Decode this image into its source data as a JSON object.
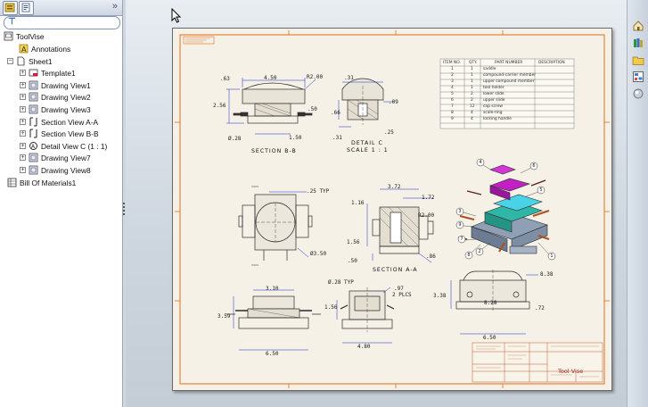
{
  "feature_tree": {
    "tabs": [
      "feature-manager-tab",
      "property-manager-tab"
    ],
    "filter_icon": "filter-icon",
    "nodes": [
      {
        "label": "ToolVise",
        "icon": "drawing-document-icon",
        "level": 0,
        "expander": ""
      },
      {
        "label": "Annotations",
        "icon": "annotations-icon",
        "level": 1,
        "expander": ""
      },
      {
        "label": "Sheet1",
        "icon": "sheet-icon",
        "level": 1,
        "expander": "−"
      },
      {
        "label": "Template1",
        "icon": "sheet-format-icon",
        "level": 2,
        "expander": "+"
      },
      {
        "label": "Drawing View1",
        "icon": "drawing-view-icon",
        "level": 2,
        "expander": "+"
      },
      {
        "label": "Drawing View2",
        "icon": "drawing-view-icon",
        "level": 2,
        "expander": "+"
      },
      {
        "label": "Drawing View3",
        "icon": "drawing-view-icon",
        "level": 2,
        "expander": "+"
      },
      {
        "label": "Section View A-A",
        "icon": "section-view-icon",
        "level": 2,
        "expander": "+"
      },
      {
        "label": "Section View B-B",
        "icon": "section-view-icon",
        "level": 2,
        "expander": "+"
      },
      {
        "label": "Detail View C (1 : 1)",
        "icon": "detail-view-icon",
        "level": 2,
        "expander": "+"
      },
      {
        "label": "Drawing View7",
        "icon": "drawing-view-icon",
        "level": 2,
        "expander": "+"
      },
      {
        "label": "Drawing View8",
        "icon": "drawing-view-icon",
        "level": 2,
        "expander": "+"
      },
      {
        "label": "Bill Of Materials1",
        "icon": "bom-table-icon",
        "level": 1,
        "expander": ""
      }
    ]
  },
  "drawing": {
    "title_block_title": "Tool Vise",
    "view_labels": {
      "section_bb": "SECTION B-B",
      "detail_c": "DETAIL C",
      "detail_scale": "SCALE 1 : 1",
      "section_aa": "SECTION A-A"
    },
    "bom": {
      "headers": [
        "ITEM NO.",
        "QTY.",
        "PART NUMBER",
        "DESCRIPTION"
      ],
      "rows": [
        [
          "1",
          "1",
          "saddle",
          ""
        ],
        [
          "2",
          "1",
          "compound-carrier member",
          ""
        ],
        [
          "3",
          "1",
          "upper compound member",
          ""
        ],
        [
          "4",
          "1",
          "tool holder",
          ""
        ],
        [
          "5",
          "2",
          "lower slide",
          ""
        ],
        [
          "6",
          "2",
          "upper slide",
          ""
        ],
        [
          "7",
          "12",
          "cap screw",
          ""
        ],
        [
          "8",
          "4",
          "scale-ring",
          ""
        ],
        [
          "9",
          "4",
          "locking handle",
          ""
        ]
      ]
    },
    "dimensions": {
      "d450": "4.50",
      "d63": ".63",
      "r200": "R2.00",
      "d256": "2.56",
      "d50": ".50",
      "d150": "1.50",
      "dia28": "Ø.28",
      "d31a": ".31",
      "d66": ".66",
      "d09": ".09",
      "d31b": ".31",
      "d25": ".25",
      "d25typ": ".25 TYP",
      "dia350": "Ø3.50",
      "d372": "3.72",
      "d172": "1.72",
      "d116": "1.16",
      "r200b": "R2.00",
      "d156a": "1.56",
      "d50b": ".50",
      "d86": ".86",
      "d838a": "8.38",
      "d338": "3.38",
      "d828": "8.28",
      "d72": ".72",
      "d650a": "6.50",
      "d310": "3.10",
      "d359": "3.59",
      "d650b": "6.50",
      "dia28typ": "Ø.28 TYP",
      "d97": ".97",
      "d2plcs": "2 PLCS",
      "d156b": "1.56",
      "d480": "4.80"
    },
    "balloons": [
      "4",
      "6",
      "5",
      "3",
      "9",
      "7",
      "8",
      "2",
      "1"
    ]
  },
  "colors": {
    "sheet": "#f5f1e6",
    "border_orange": "#e0701c",
    "dimension_blue": "#1b2bd0",
    "geometry": "#2b2b2b",
    "title_red": "#9a1d1d",
    "iso_magenta": "#c21fc5",
    "iso_teal": "#2fb6a6",
    "iso_cyan": "#4ad3e6"
  }
}
